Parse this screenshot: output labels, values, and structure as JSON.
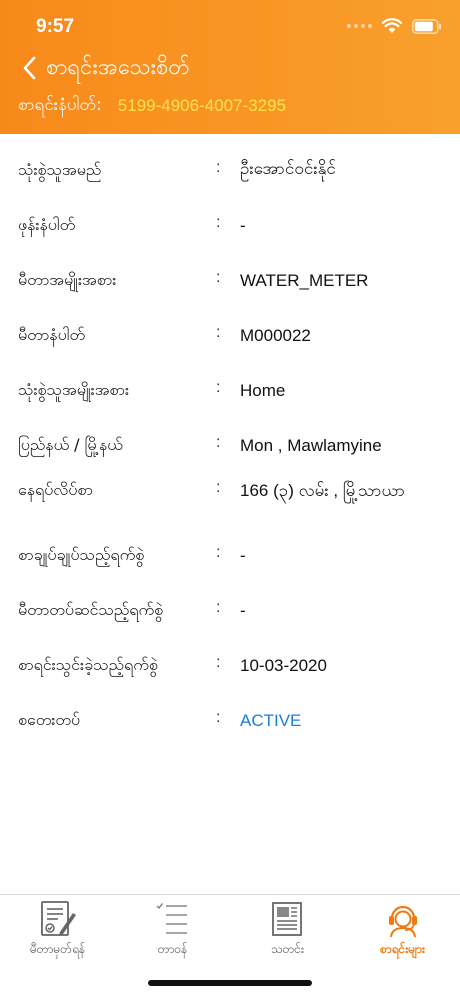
{
  "status_bar": {
    "time": "9:57"
  },
  "header": {
    "title": "စာရင်းအသေးစိတ်",
    "account_label": "စာရင်းနံပါတ်:",
    "account_number": "5199-4906-4007-3295"
  },
  "details": [
    {
      "label": "သုံးစွဲသူအမည်",
      "value": "ဦးအောင်ဝင်းနိုင်"
    },
    {
      "label": "ဖုန်းနံပါတ်",
      "value": "-"
    },
    {
      "label": "မီတာအမျိုးအစား",
      "value": "WATER_METER"
    },
    {
      "label": "မီတာနံပါတ်",
      "value": "M000022"
    },
    {
      "label": "သုံးစွဲသူအမျိုးအစား",
      "value": "Home"
    },
    {
      "label": "ပြည်နယ် / မြို့နယ်",
      "value": "Mon , Mawlamyine"
    },
    {
      "label": "နေရပ်လိပ်စာ",
      "value": "166 (၃) လမ်း  , မြို့သာယာ"
    },
    {
      "label": "စာချုပ်ချုပ်သည့်ရက်စွဲ",
      "value": "-"
    },
    {
      "label": "မီတာတပ်ဆင်သည့်ရက်စွဲ",
      "value": "-"
    },
    {
      "label": "စာရင်းသွင်းခဲ့သည့်ရက်စွဲ",
      "value": "10-03-2020"
    },
    {
      "label": "စတေးတပ်",
      "value": "ACTIVE"
    }
  ],
  "separator": ":",
  "colors": {
    "accent": "#f7891a",
    "account_number": "#ffe24a",
    "active_status": "#1a7fe0"
  },
  "tabs": [
    {
      "label": "မီတာမှတ်ရန်",
      "icon": "meter-form-icon"
    },
    {
      "label": "တာဝန်",
      "icon": "task-list-icon"
    },
    {
      "label": "သတင်း",
      "icon": "news-icon"
    },
    {
      "label": "စာရင်းများ",
      "icon": "customer-support-icon",
      "selected": true
    }
  ]
}
